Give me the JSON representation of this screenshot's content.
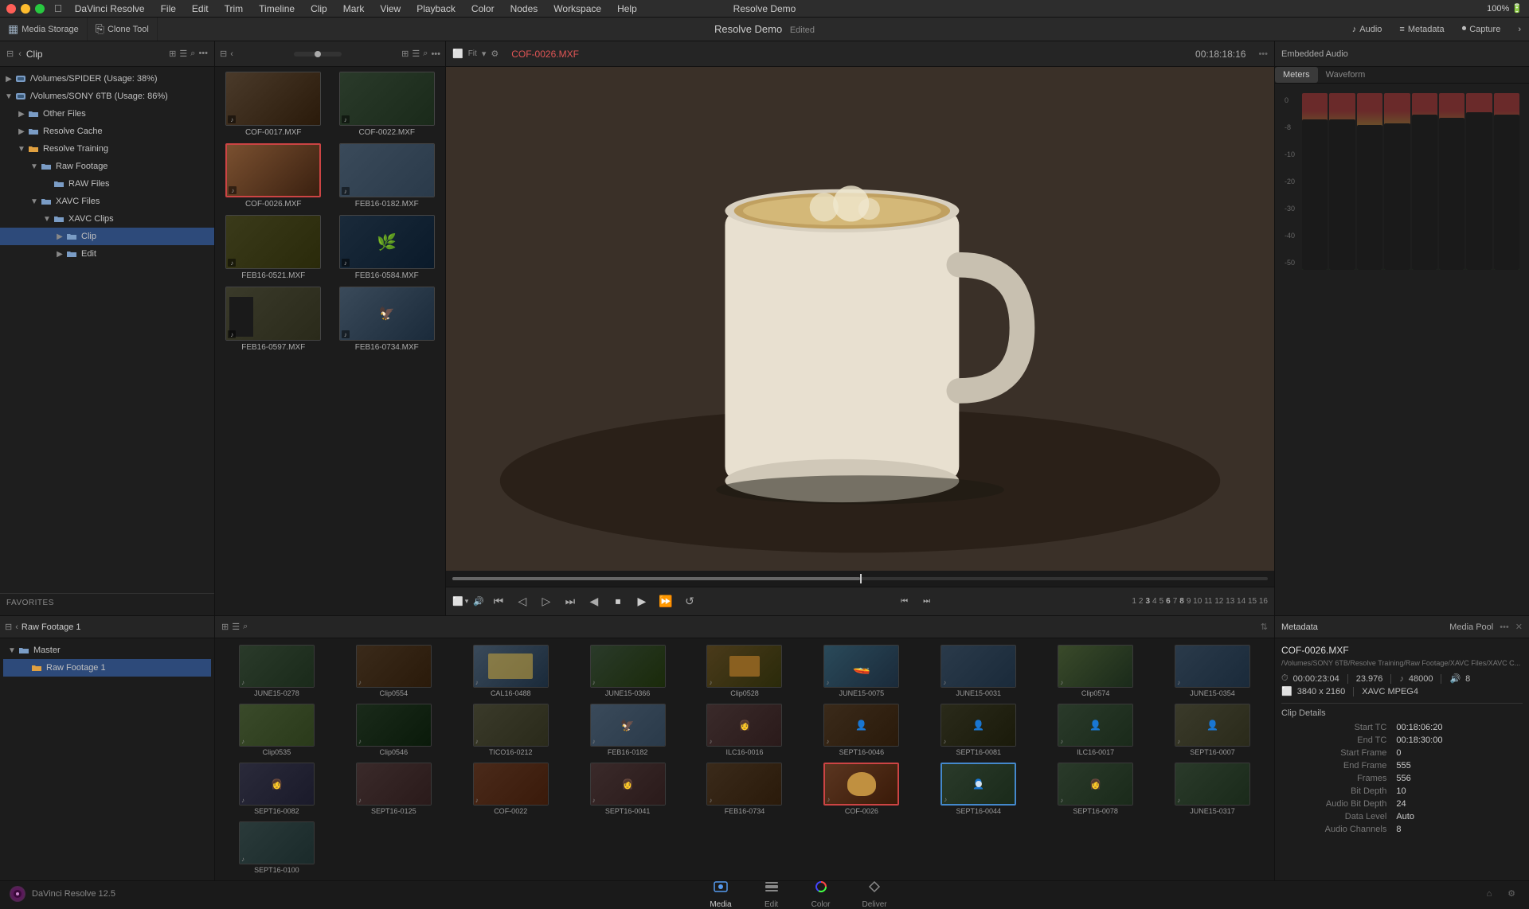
{
  "app": {
    "title": "Resolve Demo",
    "edited": "Edited",
    "version": "DaVinci Resolve 12.5"
  },
  "mac_bar": {
    "app_name": "DaVinci Resolve",
    "menus": [
      "File",
      "Edit",
      "Trim",
      "Timeline",
      "Clip",
      "Mark",
      "View",
      "Playback",
      "Color",
      "Nodes",
      "Workspace",
      "Help"
    ],
    "time": "100% 🔋"
  },
  "toolbar": {
    "media_storage": "Media Storage",
    "clone_tool": "Clone Tool",
    "project_title": "Resolve Demo",
    "edited": "Edited",
    "audio": "Audio",
    "metadata": "Metadata",
    "capture": "Capture"
  },
  "left_panel": {
    "title": "Clip",
    "items": [
      {
        "label": "/Volumes/SPIDER (Usage: 38%)",
        "depth": 0,
        "arrow": "▶",
        "type": "drive"
      },
      {
        "label": "/Volumes/SONY 6TB (Usage: 86%)",
        "depth": 0,
        "arrow": "▼",
        "type": "drive"
      },
      {
        "label": "Other Files",
        "depth": 1,
        "arrow": "▶",
        "type": "folder"
      },
      {
        "label": "Resolve Cache",
        "depth": 1,
        "arrow": "▶",
        "type": "folder"
      },
      {
        "label": "Resolve Training",
        "depth": 1,
        "arrow": "▼",
        "type": "folder"
      },
      {
        "label": "Raw Footage",
        "depth": 2,
        "arrow": "▼",
        "type": "folder"
      },
      {
        "label": "RAW Files",
        "depth": 3,
        "arrow": "",
        "type": "folder"
      },
      {
        "label": "XAVC Files",
        "depth": 2,
        "arrow": "▼",
        "type": "folder"
      },
      {
        "label": "XAVC Clips",
        "depth": 3,
        "arrow": "▼",
        "type": "folder"
      },
      {
        "label": "Clip",
        "depth": 4,
        "arrow": "▶",
        "type": "item"
      },
      {
        "label": "Edit",
        "depth": 4,
        "arrow": "▶",
        "type": "item"
      }
    ]
  },
  "clips_panel": {
    "clips": [
      {
        "name": "COF-0017.MXF",
        "color": "c1"
      },
      {
        "name": "COF-0022.MXF",
        "color": "c2"
      },
      {
        "name": "COF-0026.MXF",
        "color": "c-sel",
        "selected": true
      },
      {
        "name": "FEB16-0182.MXF",
        "color": "c3"
      },
      {
        "name": "FEB16-0521.MXF",
        "color": "c4"
      },
      {
        "name": "FEB16-0584.MXF",
        "color": "c5"
      },
      {
        "name": "FEB16-0597.MXF",
        "color": "c6"
      },
      {
        "name": "FEB16-0734.MXF",
        "color": "c7"
      }
    ]
  },
  "preview": {
    "filename": "COF-0026.MXF",
    "timecode": "00:18:18:16",
    "embedded_audio": "Embedded Audio",
    "audio_tabs": [
      "Meters",
      "Waveform"
    ]
  },
  "bottom_left": {
    "title": "Raw Footage 1",
    "bins": [
      {
        "label": "Master",
        "arrow": "▼"
      },
      {
        "label": "Raw Footage 1",
        "depth": 1
      }
    ]
  },
  "grid_clips": [
    {
      "name": "JUNE15-0278",
      "color": "c9"
    },
    {
      "name": "Clip0554",
      "color": "c10"
    },
    {
      "name": "CAL16-0488",
      "color": "c3"
    },
    {
      "name": "JUNE15-0366",
      "color": "c5"
    },
    {
      "name": "Clip0528",
      "color": "c4"
    },
    {
      "name": "JUNE15-0075",
      "color": "c11"
    },
    {
      "name": "JUNE15-0031",
      "color": "c8"
    },
    {
      "name": "Clip0574",
      "color": "c12"
    },
    {
      "name": "JUNE15-0354",
      "color": "c2"
    },
    {
      "name": "Clip0535",
      "color": "c6"
    },
    {
      "name": "Clip0546",
      "color": "c7"
    },
    {
      "name": "TICO16-0212",
      "color": "c1"
    },
    {
      "name": "FEB16-0182",
      "color": "c9"
    },
    {
      "name": "ILC16-0016",
      "color": "c10"
    },
    {
      "name": "SEPT16-0046",
      "color": "c3"
    },
    {
      "name": "SEPT16-0081",
      "color": "c5"
    },
    {
      "name": "ILC16-0017",
      "color": "c4"
    },
    {
      "name": "SEPT16-0007",
      "color": "c11"
    },
    {
      "name": "SEPT16-0082",
      "color": "c8"
    },
    {
      "name": "SEPT16-0125",
      "color": "c12"
    },
    {
      "name": "COF-0022",
      "color": "c2"
    },
    {
      "name": "SEPT16-0041",
      "color": "c6"
    },
    {
      "name": "FEB16-0734",
      "color": "c7"
    },
    {
      "name": "COF-0026",
      "color": "c-sel",
      "selected": true
    },
    {
      "name": "SEPT16-0044",
      "color": "c1",
      "selected2": true
    },
    {
      "name": "SEPT16-0078",
      "color": "c9"
    },
    {
      "name": "JUNE15-0317",
      "color": "c10"
    },
    {
      "name": "SEPT16-0100",
      "color": "c3"
    }
  ],
  "metadata": {
    "filename": "COF-0026.MXF",
    "path": "/Volumes/SONY 6TB/Resolve Training/Raw Footage/XAVC Files/XAVC C...",
    "duration": "00:00:23:04",
    "fps": "23.976",
    "sample_rate": "48000",
    "channels": "8",
    "resolution": "3840 x 2160",
    "codec": "XAVC MPEG4",
    "clip_details": {
      "start_tc": "00:18:06:20",
      "end_tc": "00:18:30:00",
      "start_frame": "0",
      "end_frame": "555",
      "frames": "556",
      "bit_depth": "10",
      "audio_bit_depth": "24",
      "data_level": "Auto",
      "audio_channels": "8"
    }
  },
  "app_tabs": [
    {
      "label": "Media",
      "active": true
    },
    {
      "label": "Edit",
      "active": false
    },
    {
      "label": "Color",
      "active": false
    },
    {
      "label": "Deliver",
      "active": false
    }
  ]
}
